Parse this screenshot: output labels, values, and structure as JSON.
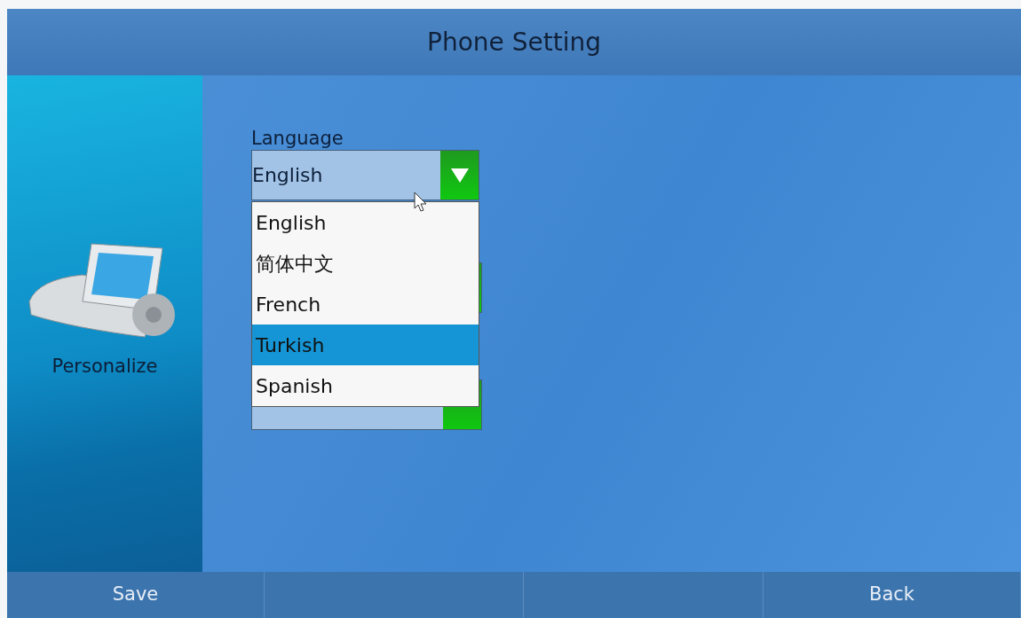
{
  "window": {
    "title": "Phone Setting"
  },
  "sidebar": {
    "label": "Personalize"
  },
  "language_field": {
    "label": "Language",
    "value": "English",
    "expanded": true
  },
  "covered_fields": [
    {
      "kind": "dropdown"
    },
    {
      "kind": "dropdown"
    }
  ],
  "dropdown_options": [
    {
      "label": "English",
      "selected": false
    },
    {
      "label": "简体中文",
      "selected": false
    },
    {
      "label": "French",
      "selected": false
    },
    {
      "label": "Turkish",
      "selected": true
    },
    {
      "label": "Spanish",
      "selected": false
    }
  ],
  "softkeys": [
    {
      "kind": "key",
      "label": "Save"
    },
    {
      "kind": "blank"
    },
    {
      "kind": "blank"
    },
    {
      "kind": "key",
      "label": "Back"
    }
  ]
}
